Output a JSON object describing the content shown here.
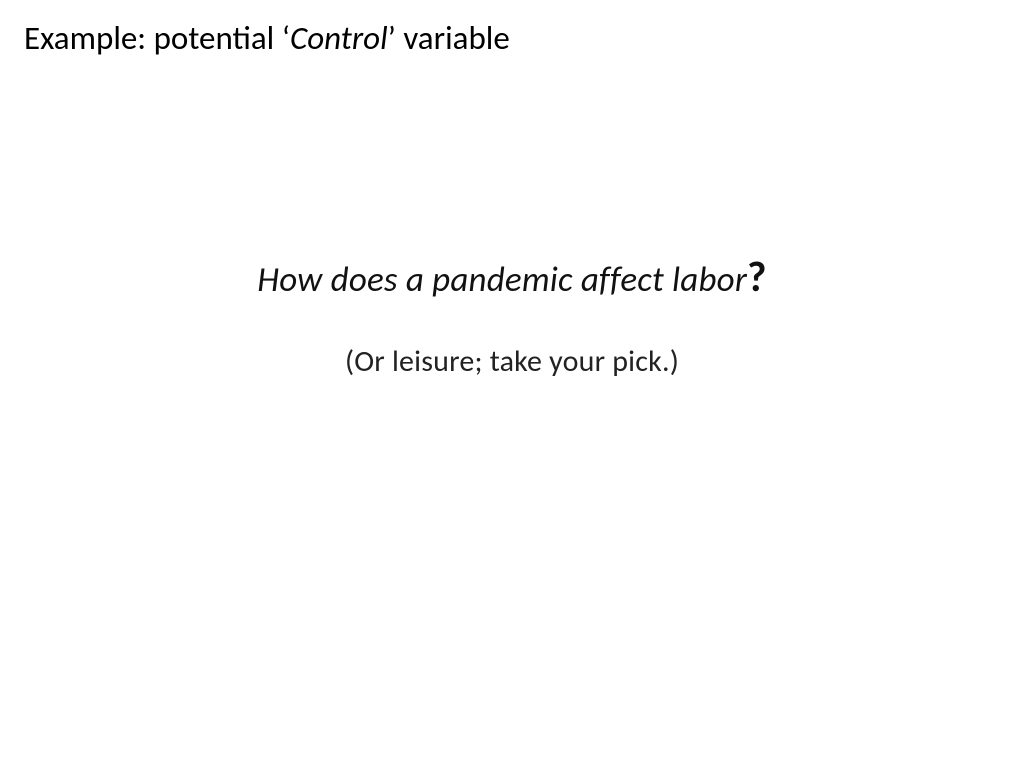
{
  "title": {
    "prefix": "Example: potential ‘",
    "italic": "Control",
    "suffix": "’ variable"
  },
  "main": {
    "question_text": "How does a pandemic affect labor",
    "question_mark": "?",
    "subtext": "(Or leisure; take your pick.)"
  }
}
